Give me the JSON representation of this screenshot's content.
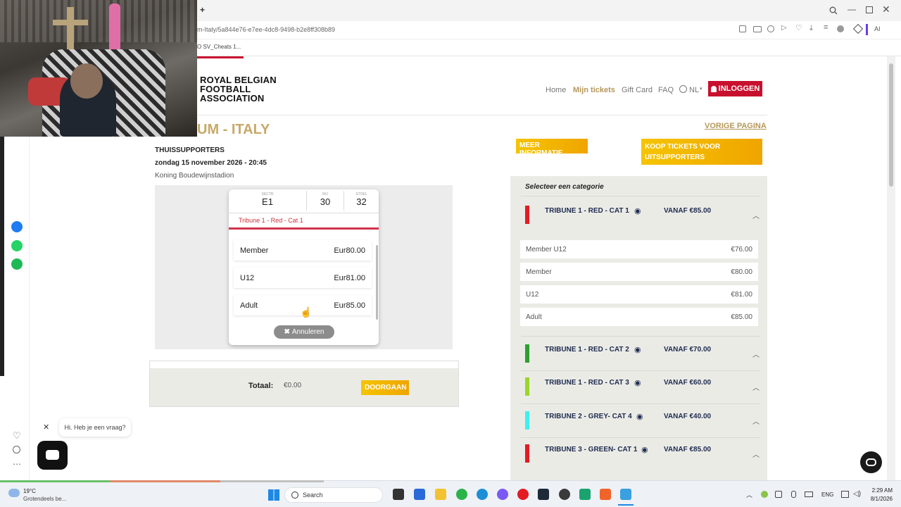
{
  "browser": {
    "url": "m-Italy/5a844e76-e7ee-4dc8-9498-b2e8ff308b89",
    "bookmark": "O SV_Cheats 1...",
    "new_tab": "+",
    "ai_label": "AI"
  },
  "site": {
    "logo_line1": "ROYAL BELGIAN",
    "logo_line2": "FOOTBALL",
    "logo_line3": "ASSOCIATION",
    "nav": {
      "home": "Home",
      "my_tickets": "Mijn tickets",
      "gift_card": "Gift Card",
      "faq": "FAQ",
      "lang": "NL",
      "login": "INLOGGEN"
    }
  },
  "event": {
    "title": "UM - ITALY",
    "back_link": "VORIGE PAGINA",
    "section": "THUISSUPPORTERS",
    "datetime": "zondag 15 november 2026 - 20:45",
    "venue": "Koning Boudewijnstadion",
    "more_info": "MEER INFORMATIE",
    "away_tickets_line1": "KOOP TICKETS VOOR",
    "away_tickets_line2": "UITSUPPORTERS"
  },
  "seat_popup": {
    "sector_label": "SECTR",
    "sector": "E1",
    "row_label": "RIJ",
    "row": "30",
    "seat_label": "STOEL",
    "seat": "32",
    "category": "Tribune 1 - Red - Cat 1",
    "options": [
      {
        "name": "Member",
        "price": "Eur80.00"
      },
      {
        "name": "U12",
        "price": "Eur81.00"
      },
      {
        "name": "Adult",
        "price": "Eur85.00"
      }
    ],
    "cancel": "Annuleren"
  },
  "total": {
    "label": "Totaal:",
    "value": "€0.00",
    "continue": "DOORGAAN"
  },
  "categories": {
    "heading": "Selecteer een categorie",
    "items": [
      {
        "name": "TRIBUNE 1 - RED - CAT 1",
        "price": "VANAF €85.00",
        "color": "#e31b23"
      },
      {
        "name": "TRIBUNE 1 - RED - CAT 2",
        "price": "VANAF €70.00",
        "color": "#2e9e2e"
      },
      {
        "name": "TRIBUNE 1 - RED - CAT 3",
        "price": "VANAF €60.00",
        "color": "#9ad62a"
      },
      {
        "name": "TRIBUNE 2 - GREY- CAT 4",
        "price": "VANAF €40.00",
        "color": "#3ef0ee"
      },
      {
        "name": "TRIBUNE 3 - GREEN- CAT 1",
        "price": "VANAF €85.00",
        "color": "#e31b23"
      }
    ],
    "cat1_prices": [
      {
        "name": "Member U12",
        "price": "€76.00"
      },
      {
        "name": "Member",
        "price": "€80.00"
      },
      {
        "name": "U12",
        "price": "€81.00"
      },
      {
        "name": "Adult",
        "price": "€85.00"
      }
    ]
  },
  "chat": {
    "bubble": "Hi. Heb je een vraag?"
  },
  "taskbar": {
    "weather_temp": "19°C",
    "weather_desc": "Grotendeels be...",
    "search": "Search",
    "lang": "ENG",
    "time": "2:29 AM",
    "date": "8/1/2026"
  },
  "colors": {
    "accent_gold": "#b5975a",
    "login_red": "#c8102e",
    "title_gold": "#c8a86a",
    "navy": "#1d2b4f"
  }
}
